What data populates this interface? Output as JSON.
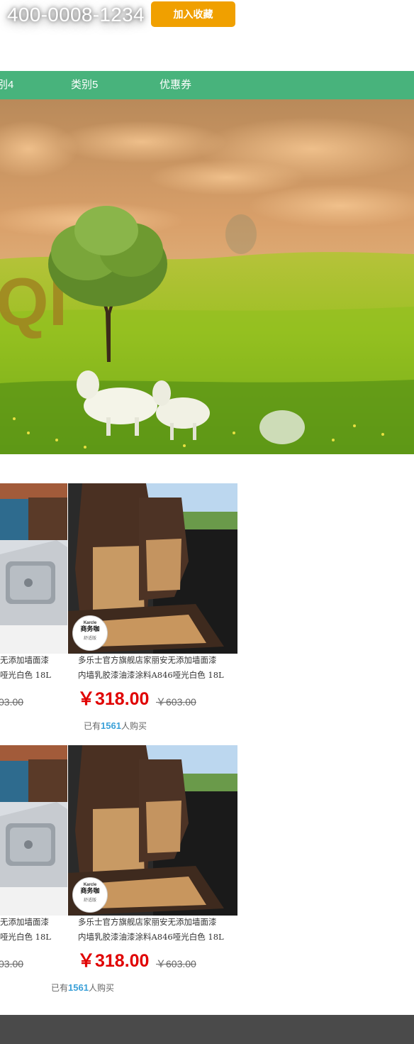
{
  "header": {
    "hotline": "400-0008-1234",
    "favorite_button": "加入收藏"
  },
  "nav": {
    "items": [
      "别4",
      "类别5",
      "优惠券"
    ]
  },
  "hero": {
    "logo_partial": "QI"
  },
  "products": [
    {
      "left_title_line1": "无添加墙面漆",
      "left_title_line2": "哑光白色 18L",
      "left_old_price": "03.00",
      "title_line1": "多乐士官方旗舰店家丽安无添加墙面漆",
      "title_line2": "内墙乳胶漆油漆涂料A846哑光白色 18L",
      "price": "￥318.00",
      "old_price": "￥603.00",
      "buyers_prefix": "已有",
      "buyers_count": "1561",
      "buyers_suffix": "人购买",
      "badge_brand": "Karcle",
      "badge_title": "商务咖",
      "badge_sub": "舒适版"
    },
    {
      "left_title_line1": "无添加墙面漆",
      "left_title_line2": "哑光白色 18L",
      "left_old_price": "03.00",
      "title_line1": "多乐士官方旗舰店家丽安无添加墙面漆",
      "title_line2": "内墙乳胶漆油漆涂料A846哑光白色 18L",
      "price": "￥318.00",
      "old_price": "￥603.00",
      "buyers_prefix": "已有",
      "buyers_count": "1561",
      "buyers_suffix": "人购买",
      "badge_brand": "Karcle",
      "badge_title": "商务咖",
      "badge_sub": "舒适版"
    }
  ],
  "colors": {
    "nav_green": "#48b37c",
    "button_orange": "#f0a000",
    "price_red": "#e00000",
    "count_blue": "#3aa0d8",
    "footer_gray": "#4a4a4a"
  }
}
